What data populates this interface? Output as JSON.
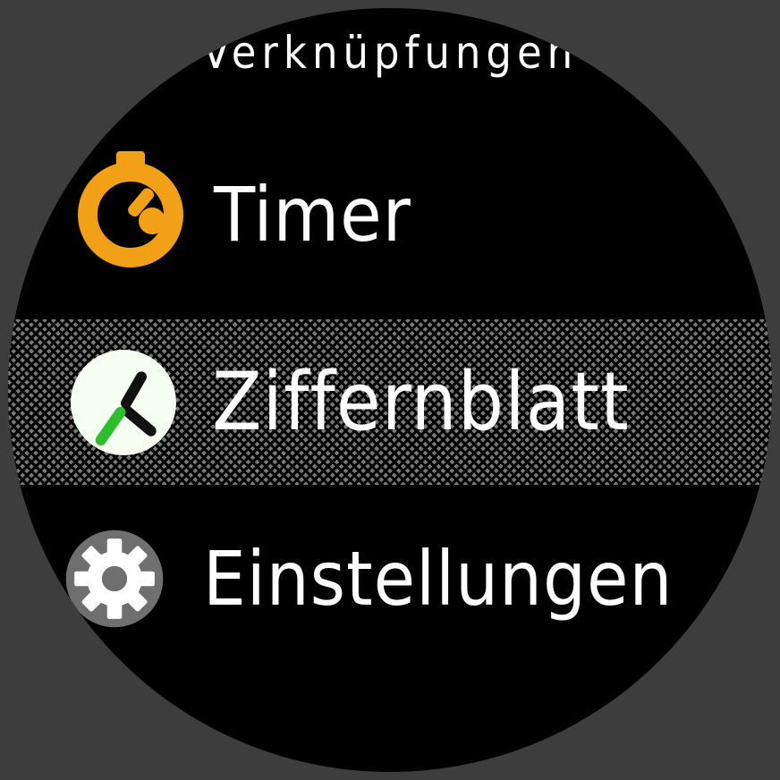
{
  "header": {
    "title": "Verknüpfungen"
  },
  "menu": {
    "timer": {
      "label": "Timer"
    },
    "face": {
      "label": "Ziffernblatt"
    },
    "settings": {
      "label": "Einstellungen"
    }
  }
}
